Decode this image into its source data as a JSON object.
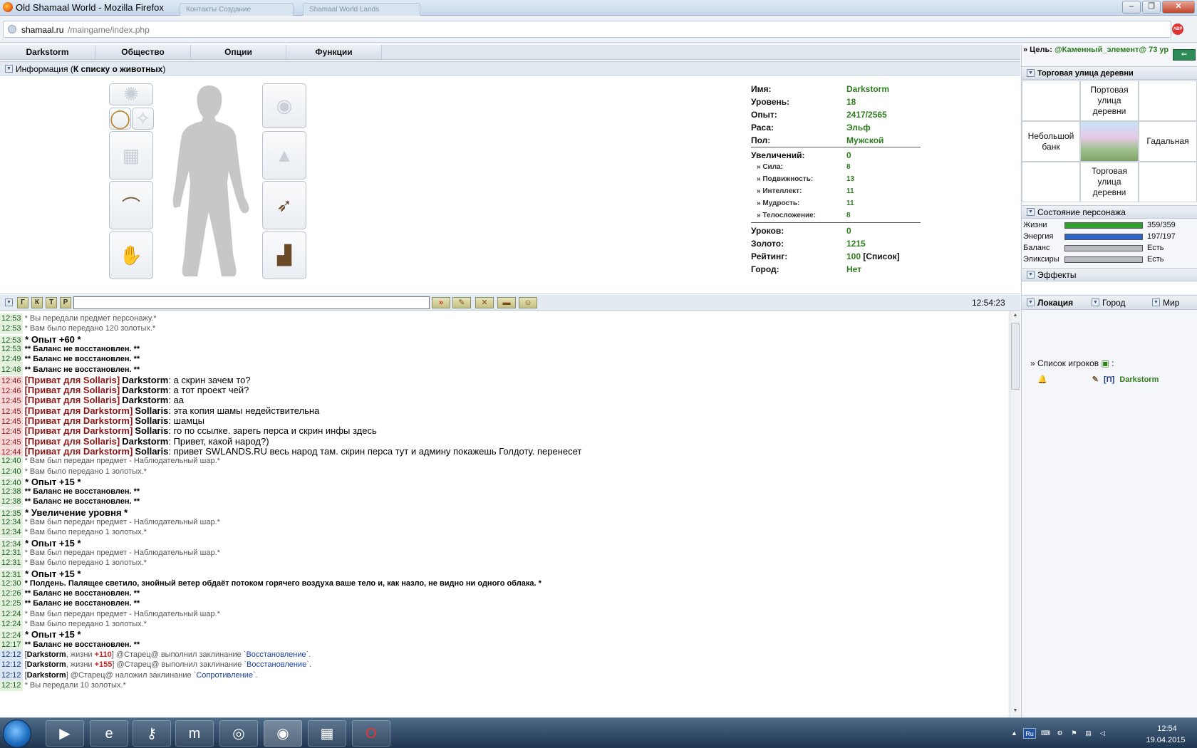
{
  "window": {
    "title": "Old Shamaal World - Mozilla Firefox",
    "ghost_tabs": [
      "Контакты Создание",
      "Shamaal World Lands"
    ]
  },
  "browser": {
    "url_host": "shamaal.ru",
    "url_path": "/maingame/index.php",
    "abp_label": "ABP"
  },
  "menu": {
    "items": [
      "Darkstorm",
      "Общество",
      "Опции",
      "Функции"
    ]
  },
  "info": {
    "title": "Информация",
    "link_open": " (",
    "link": "К списку о животных",
    "link_close": ")"
  },
  "stats": {
    "name_label": "Имя:",
    "name": "Darkstorm",
    "level_label": "Уровень:",
    "level": "18",
    "exp_label": "Опыт:",
    "exp": "2417/2565",
    "race_label": "Раса:",
    "race": "Эльф",
    "sex_label": "Пол:",
    "sex": "Мужской",
    "incr_label": "Увеличений:",
    "incr": "0",
    "str_label": "» Сила:",
    "str": "8",
    "agi_label": "» Подвижность:",
    "agi": "13",
    "int_label": "» Интеллект:",
    "int": "11",
    "wis_label": "» Мудрость:",
    "wis": "11",
    "con_label": "» Телосложение:",
    "con": "8",
    "lessons_label": "Уроков:",
    "lessons": "0",
    "gold_label": "Золото:",
    "gold": "1215",
    "rating_label": "Рейтинг:",
    "rating": "100",
    "rating_list": "[Список]",
    "city_label": "Город:",
    "city": "Нет"
  },
  "chatbar": {
    "buttons": [
      "Г",
      "К",
      "Т",
      "Р"
    ],
    "input_value": "",
    "send": "»",
    "time": "12:54:23"
  },
  "chat": [
    {
      "t": "12:53",
      "kind": "sys",
      "text": "* Вы передали предмет персонажу.*"
    },
    {
      "t": "12:53",
      "kind": "sys",
      "text": "* Вам было передано 120 золотых.*"
    },
    {
      "t": "12:53",
      "kind": "big",
      "text": " * Опыт +60 *"
    },
    {
      "t": "12:53",
      "kind": "bold",
      "text": "** Баланс не восстановлен. **"
    },
    {
      "t": "12:49",
      "kind": "bold",
      "text": "** Баланс не восстановлен. **"
    },
    {
      "t": "12:48",
      "kind": "bold",
      "text": "** Баланс не восстановлен. **"
    },
    {
      "t": "12:46",
      "kind": "priv",
      "to": "[Приват для Sollaris]",
      "nick": "Darkstorm",
      "msg": ": а скрин зачем то?"
    },
    {
      "t": "12:46",
      "kind": "priv",
      "to": "[Приват для Sollaris]",
      "nick": "Darkstorm",
      "msg": ": а тот проект чей?"
    },
    {
      "t": "12:45",
      "kind": "priv",
      "to": "[Приват для Sollaris]",
      "nick": "Darkstorm",
      "msg": ": аа"
    },
    {
      "t": "12:45",
      "kind": "priv",
      "to": "[Приват для Darkstorm]",
      "nick": "Sollaris",
      "msg": ": эта копия шамы недействительна"
    },
    {
      "t": "12:45",
      "kind": "priv",
      "to": "[Приват для Darkstorm]",
      "nick": "Sollaris",
      "msg": ": шамцы"
    },
    {
      "t": "12:45",
      "kind": "priv",
      "to": "[Приват для Darkstorm]",
      "nick": "Sollaris",
      "msg": ": го по ссылке. зарегь перса и скрин инфы здесь"
    },
    {
      "t": "12:45",
      "kind": "priv",
      "to": "[Приват для Sollaris]",
      "nick": "Darkstorm",
      "msg": ": Привет, какой народ?)"
    },
    {
      "t": "12:44",
      "kind": "priv",
      "to": "[Приват для Darkstorm]",
      "nick": "Sollaris",
      "msg": ": привет SWLANDS.RU весь народ там. скрин перса тут и админу покажешь Голдоту. перенесет"
    },
    {
      "t": "12:40",
      "kind": "sys",
      "text": "* Вам был передан предмет - Наблюдательный шар.*"
    },
    {
      "t": "12:40",
      "kind": "sys",
      "text": "* Вам было передано 1 золотых.*"
    },
    {
      "t": "12:40",
      "kind": "big",
      "text": " * Опыт +15 *"
    },
    {
      "t": "12:38",
      "kind": "bold",
      "text": "** Баланс не восстановлен. **"
    },
    {
      "t": "12:38",
      "kind": "bold",
      "text": "** Баланс не восстановлен. **"
    },
    {
      "t": "12:35",
      "kind": "big",
      "text": " * Увеличение уровня *"
    },
    {
      "t": "12:34",
      "kind": "sys",
      "text": "* Вам был передан предмет - Наблюдательный шар.*"
    },
    {
      "t": "12:34",
      "kind": "sys",
      "text": "* Вам было передано 1 золотых.*"
    },
    {
      "t": "12:34",
      "kind": "big",
      "text": " * Опыт +15 *"
    },
    {
      "t": "12:31",
      "kind": "sys",
      "text": "* Вам был передан предмет - Наблюдательный шар.*"
    },
    {
      "t": "12:31",
      "kind": "sys",
      "text": "* Вам было передано 1 золотых.*"
    },
    {
      "t": "12:31",
      "kind": "big",
      "text": " * Опыт +15 *"
    },
    {
      "t": "12:30",
      "kind": "bold",
      "text": "* Полдень. Палящее светило, знойный ветер обдаёт потоком горячего воздуха ваше тело и, как назло, не видно ни одного облака. *"
    },
    {
      "t": "12:26",
      "kind": "bold",
      "text": "** Баланс не восстановлен. **"
    },
    {
      "t": "12:25",
      "kind": "bold",
      "text": "** Баланс не восстановлен. **"
    },
    {
      "t": "12:24",
      "kind": "sys",
      "text": "* Вам был передан предмет - Наблюдательный шар.*"
    },
    {
      "t": "12:24",
      "kind": "sys",
      "text": "* Вам было передано 1 золотых.*"
    },
    {
      "t": "12:24",
      "kind": "big",
      "text": " * Опыт +15 *"
    },
    {
      "t": "12:17",
      "kind": "bold",
      "text": "** Баланс не восстановлен. **"
    },
    {
      "t": "12:12",
      "kind": "spell",
      "who": "Darkstorm",
      "hp_text": ", жизни ",
      "hp": "+110",
      "caster": "] @Старец@",
      "verb": " выполнил заклинание `",
      "spell": "Восстановление",
      "end": "`."
    },
    {
      "t": "12:12",
      "kind": "spell",
      "who": "Darkstorm",
      "hp_text": ", жизни ",
      "hp": "+155",
      "caster": "] @Старец@",
      "verb": " выполнил заклинание `",
      "spell": "Восстановление",
      "end": "`."
    },
    {
      "t": "12:12",
      "kind": "spell2",
      "who": "Darkstorm",
      "caster": "] @Старец@",
      "verb": " наложил заклинание `",
      "spell": "Сопротивление",
      "end": "`."
    },
    {
      "t": "12:12",
      "kind": "sys",
      "text": "* Вы передали 10 золотых.*"
    }
  ],
  "right": {
    "target_prefix": "» Цель: ",
    "target_name": "@Каменный_элемент@ 73 ур",
    "exit_label": "⇐",
    "location_title": "Торговая улица деревни",
    "cells": {
      "north": "Портовая улица деревни",
      "west": "Небольшой банк",
      "east": "Гадальная",
      "south": "Торговая улица деревни"
    },
    "state_title": "Состояние персонажа",
    "bars": [
      {
        "label": "Жизни",
        "value": "359/359",
        "fill": 1.0,
        "color": "#2fa12f"
      },
      {
        "label": "Энергия",
        "value": "197/197",
        "fill": 1.0,
        "color": "#2b63c6"
      },
      {
        "label": "Баланс",
        "value": "Есть",
        "fill": 1.0,
        "color": "#b8bcc2"
      },
      {
        "label": "Эликсиры",
        "value": "Есть",
        "fill": 1.0,
        "color": "#b8bcc2"
      }
    ],
    "effects_title": "Эффекты",
    "tabs": [
      "Локация",
      "Город",
      "Мир"
    ],
    "players_title": "» Список игроков",
    "players_colon": " :",
    "player_tag": "[П]",
    "player_name": "Darkstorm"
  },
  "tray": {
    "lang": "Ru",
    "time": "12:54",
    "date": "19.04.2015"
  }
}
